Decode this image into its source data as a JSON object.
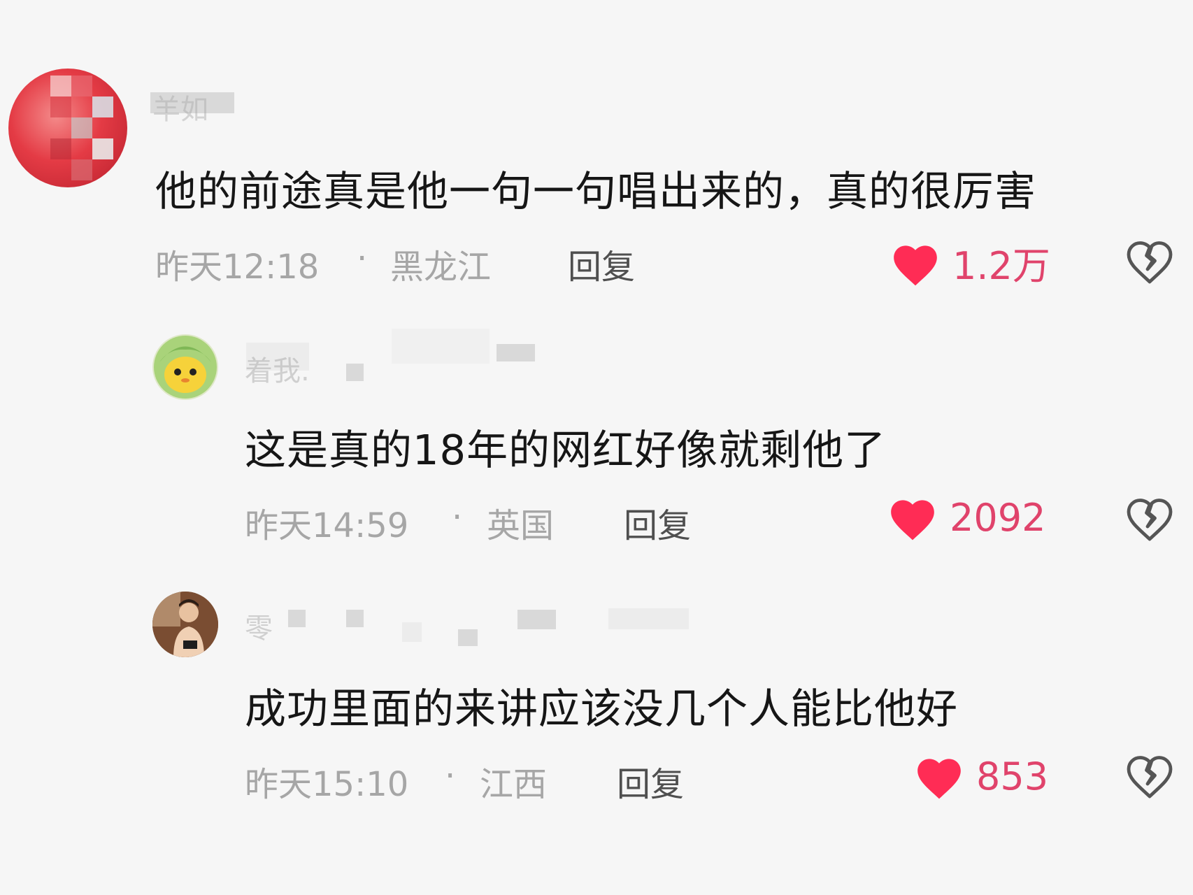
{
  "colors": {
    "background": "#f6f6f6",
    "heart": "#ff2c55",
    "count": "#e0436b",
    "meta": "#a6a6a6",
    "reply": "#4f4f4f"
  },
  "icons": {
    "like": "heart-icon",
    "dislike": "broken-heart-icon"
  },
  "comments": [
    {
      "author": "羊如",
      "text": "他的前途真是他一句一句唱出来的，真的很厉害",
      "time": "昨天12:18",
      "separator": "·",
      "location": "黑龙江",
      "reply_label": "回复",
      "likes": "1.2万"
    },
    {
      "author": "着我.",
      "text": "这是真的18年的网红好像就剩他了",
      "time": "昨天14:59",
      "separator": "·",
      "location": "英国",
      "reply_label": "回复",
      "likes": "2092"
    },
    {
      "author": "零",
      "text": "成功里面的来讲应该没几个人能比他好",
      "time": "昨天15:10",
      "separator": "·",
      "location": "江西",
      "reply_label": "回复",
      "likes": "853"
    }
  ]
}
